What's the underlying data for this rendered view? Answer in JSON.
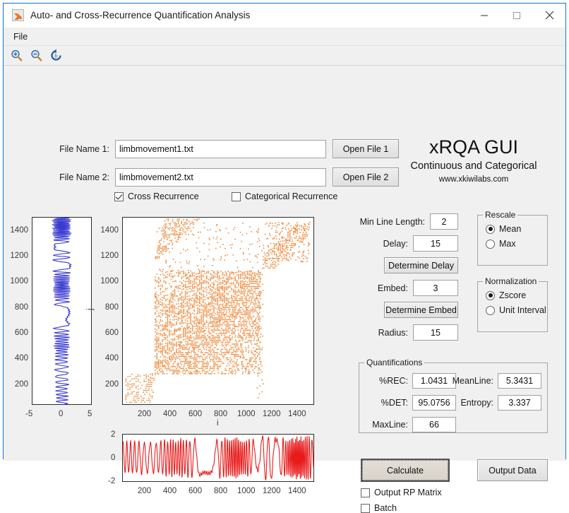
{
  "window": {
    "title": "Auto- and Cross-Recurrence Quantification Analysis",
    "app_icon": "matlab-figure-icon",
    "minimize": "─",
    "maximize": "☐",
    "close": "✕"
  },
  "menubar": {
    "items": [
      {
        "label": "File"
      }
    ]
  },
  "toolbar": {
    "buttons": [
      {
        "name": "zoom-in-icon",
        "tip": "Zoom In"
      },
      {
        "name": "zoom-out-icon",
        "tip": "Zoom Out"
      },
      {
        "name": "restore-view-icon",
        "tip": "Restore View"
      }
    ]
  },
  "files": {
    "file1_label": "File Name 1:",
    "file1_value": "limbmovement1.txt",
    "file1_button": "Open File 1",
    "file2_label": "File Name 2:",
    "file2_value": "limbmovement2.txt",
    "file2_button": "Open File 2",
    "cross_recurrence_label": "Cross Recurrence",
    "cross_recurrence_checked": true,
    "categorical_recurrence_label": "Categorical Recurrence",
    "categorical_recurrence_checked": false
  },
  "brand": {
    "title": "xRQA GUI",
    "subtitle": "Continuous and Categorical",
    "url": "www.xkiwilabs.com"
  },
  "parameters": {
    "min_line_length_label": "Min Line Length:",
    "min_line_length_value": "2",
    "delay_label": "Delay:",
    "delay_value": "15",
    "determine_delay_button": "Determine Delay",
    "embed_label": "Embed:",
    "embed_value": "3",
    "determine_embed_button": "Determine Embed",
    "radius_label": "Radius:",
    "radius_value": "15"
  },
  "rescale": {
    "title": "Rescale",
    "options": [
      {
        "label": "Mean",
        "selected": true
      },
      {
        "label": "Max",
        "selected": false
      }
    ]
  },
  "normalization": {
    "title": "Normalization",
    "options": [
      {
        "label": "Zscore",
        "selected": true
      },
      {
        "label": "Unit Interval",
        "selected": false
      }
    ]
  },
  "quantifications": {
    "title": "Quantifications",
    "rec_label": "%REC:",
    "rec_value": "1.0431",
    "det_label": "%DET:",
    "det_value": "95.0756",
    "maxline_label": "MaxLine:",
    "maxline_value": "66",
    "meanline_label": "MeanLine:",
    "meanline_value": "5.3431",
    "entropy_label": "Entropy:",
    "entropy_value": "3.337"
  },
  "actions": {
    "calculate_button": "Calculate",
    "output_data_button": "Output Data",
    "output_rp_matrix_label": "Output RP Matrix",
    "output_rp_matrix_checked": false,
    "batch_label": "Batch",
    "batch_checked": false
  },
  "colors": {
    "recurrence_point": "#ED8A3C",
    "signal_1": "#3A3AD0",
    "signal_2": "#E81B1B",
    "window_border": "#0a74d4",
    "panel_bg": "#f0f0f0"
  },
  "chart_data": [
    {
      "type": "line",
      "name": "signal-1-vertical",
      "title": "",
      "xlabel": "",
      "ylabel": "",
      "orientation": "vertical",
      "color": "#3A3AD0",
      "xlim": [
        -6.2,
        6.2
      ],
      "ylim": [
        0,
        1500
      ],
      "xticks": [
        -5,
        0,
        5
      ],
      "yticks": [
        200,
        400,
        600,
        800,
        1000,
        1200,
        1400
      ],
      "description": "Z-scored limb movement 1 plotted with time on the vertical axis; quasi-periodic oscillation, amplitude roughly +/- 2 growing toward the top.",
      "n_points": 1500,
      "approx_cycles": 46,
      "amplitude_envelope": [
        1.2,
        1.4,
        1.3,
        1.5,
        1.6,
        1.5,
        1.7,
        1.8,
        1.6,
        1.9
      ]
    },
    {
      "type": "scatter",
      "name": "cross-recurrence-plot",
      "title": "",
      "xlabel": "i",
      "ylabel": "j",
      "color": "#ED8A3C",
      "xlim": [
        0,
        1500
      ],
      "ylim": [
        0,
        1500
      ],
      "xticks": [
        200,
        400,
        600,
        800,
        1000,
        1200,
        1400
      ],
      "yticks": [
        200,
        400,
        600,
        800,
        1000,
        1200,
        1400
      ],
      "grid": false,
      "recurrence_rate_percent": 1.0431,
      "description": "Cross-recurrence plot of limbmovement1 vs limbmovement2. Dense band of parallel diagonal line structures spanning roughly i=250..1080, with sparser diagonal patches at lower-left (i<250) and an upper-right diagonal band from about i=1100 to 1400."
    },
    {
      "type": "line",
      "name": "signal-2-horizontal",
      "title": "",
      "xlabel": "i",
      "ylabel": "",
      "orientation": "horizontal",
      "color": "#E81B1B",
      "xlim": [
        0,
        1500
      ],
      "ylim": [
        -2,
        2
      ],
      "xticks": [
        200,
        400,
        600,
        800,
        1000,
        1200,
        1400
      ],
      "yticks": [
        -2,
        0,
        2
      ],
      "description": "Z-scored limb movement 2 plotted against sample index; quasi-periodic oscillation with amplitude near +/- 1.5 and a larger burst around sample 1150.",
      "n_points": 1500,
      "approx_cycles": 46,
      "amplitude_envelope": [
        1.35,
        1.3,
        1.5,
        1.55,
        1.45,
        1.6,
        1.5,
        1.85,
        1.6,
        1.7
      ]
    }
  ]
}
